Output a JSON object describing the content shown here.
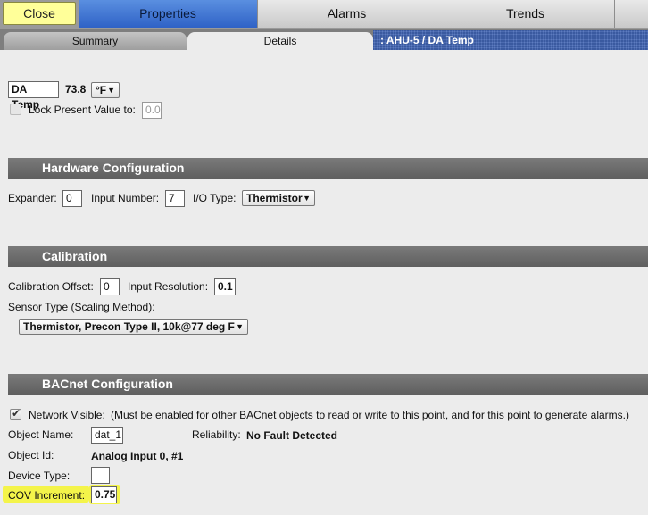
{
  "top_tabs": {
    "close_label": "Close",
    "properties_label": "Properties",
    "alarms_label": "Alarms",
    "trends_label": "Trends"
  },
  "sub_tabs": {
    "summary_label": "Summary",
    "details_label": "Details",
    "breadcrumb": ": AHU-5 / DA Temp"
  },
  "present_value": {
    "name": "DA Temp",
    "value": "73.8",
    "unit": "°F",
    "lock_label": "Lock Present Value to:",
    "lock_value": "0.0",
    "lock_checked": false
  },
  "hardware": {
    "title": "Hardware Configuration",
    "expander_label": "Expander:",
    "expander_value": "0",
    "input_number_label": "Input Number:",
    "input_number_value": "7",
    "io_type_label": "I/O Type:",
    "io_type_value": "Thermistor"
  },
  "calibration": {
    "title": "Calibration",
    "offset_label": "Calibration Offset:",
    "offset_value": "0",
    "resolution_label": "Input Resolution:",
    "resolution_value": "0.1",
    "sensor_type_label": "Sensor Type (Scaling Method):",
    "sensor_type_value": "Thermistor, Precon Type II, 10k@77 deg F"
  },
  "bacnet": {
    "title": "BACnet Configuration",
    "network_visible_label": "Network Visible:",
    "network_visible_note": "(Must be enabled for other BACnet objects to read or write to this point, and for this point to generate alarms.)",
    "network_visible_checked": true,
    "object_name_label": "Object Name:",
    "object_name_value": "dat_1",
    "reliability_label": "Reliability:",
    "reliability_value": "No Fault Detected",
    "object_id_label": "Object Id:",
    "object_id_value": "Analog Input 0, #1",
    "device_type_label": "Device Type:",
    "device_type_value": "",
    "cov_increment_label": "COV Increment:",
    "cov_increment_value": "0.75"
  },
  "colors": {
    "active_tab": "#3a6fd6",
    "close_button": "#ffff99",
    "highlight": "#f4f44a",
    "section_header": "#6c6c6c",
    "breadcrumb_bg": "#3a5aa0"
  },
  "icons": {
    "dropdown": "chevron-down-icon",
    "checkmark": "checkmark-icon"
  }
}
